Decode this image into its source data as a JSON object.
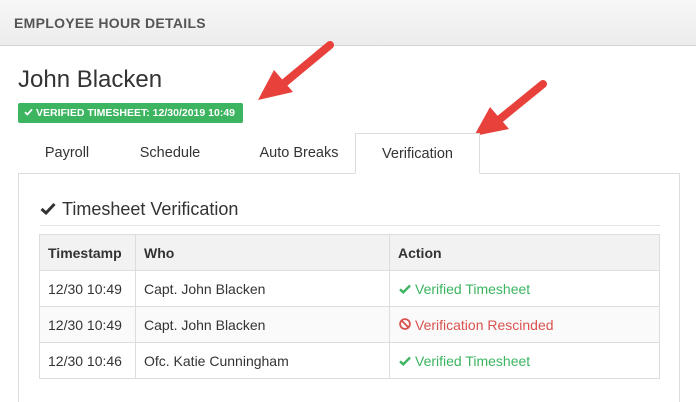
{
  "header": {
    "title": "EMPLOYEE HOUR DETAILS"
  },
  "employee": {
    "name": "John Blacken"
  },
  "badge": {
    "icon": "check-icon",
    "text": "VERIFIED TIMESHEET: 12/30/2019 10:49",
    "color": "#3cb460"
  },
  "tabs": [
    {
      "label": "Payroll",
      "active": false
    },
    {
      "label": "Schedule",
      "active": false
    },
    {
      "label": "Auto Breaks",
      "active": false
    },
    {
      "label": "Verification",
      "active": true
    }
  ],
  "section": {
    "icon": "check-icon",
    "title": "Timesheet Verification"
  },
  "table": {
    "headers": [
      "Timestamp",
      "Who",
      "Action"
    ],
    "rows": [
      {
        "timestamp": "12/30 10:49",
        "who": "Capt. John Blacken",
        "action": "Verified Timesheet",
        "status": "verified",
        "icon": "check-icon"
      },
      {
        "timestamp": "12/30 10:49",
        "who": "Capt. John Blacken",
        "action": "Verification Rescinded",
        "status": "rescinded",
        "icon": "ban-icon"
      },
      {
        "timestamp": "12/30 10:46",
        "who": "Ofc. Katie Cunningham",
        "action": "Verified Timesheet",
        "status": "verified",
        "icon": "check-icon"
      }
    ]
  },
  "colors": {
    "success": "#3cb460",
    "danger": "#d9534f",
    "annotation_arrow": "#e8403a"
  }
}
